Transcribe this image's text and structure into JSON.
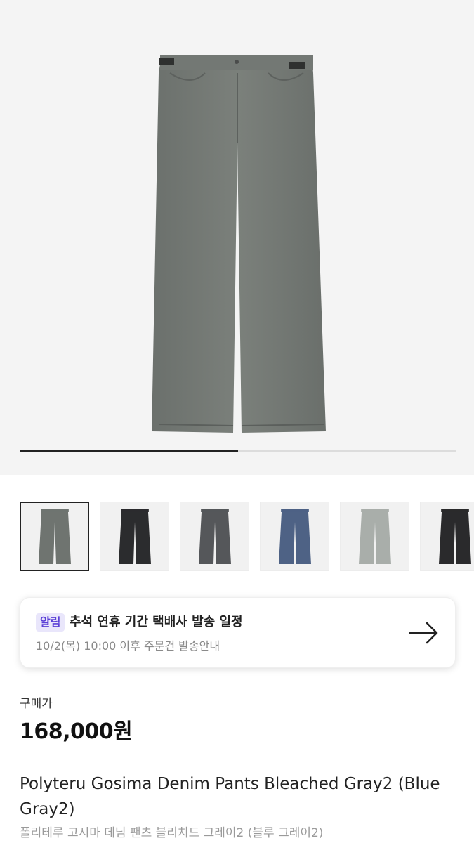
{
  "gallery": {
    "main_image": "product-photo-bleached-gray-pants",
    "progress_fraction": 0.5,
    "thumbnails": [
      {
        "name": "bleached-gray",
        "color": "#6f7470"
      },
      {
        "name": "black",
        "color": "#2b2c2e"
      },
      {
        "name": "charcoal",
        "color": "#55575a"
      },
      {
        "name": "blue",
        "color": "#4e6285"
      },
      {
        "name": "light-gray",
        "color": "#a9aeaa"
      },
      {
        "name": "black-2",
        "color": "#2a2a2c"
      }
    ]
  },
  "notice": {
    "badge": "알림",
    "title": "추석 연휴 기간 택배사 발송 일정",
    "subtitle": "10/2(목) 10:00 이후 주문건 발송안내",
    "arrow_icon": "arrow-right-icon"
  },
  "product": {
    "price_label": "구매가",
    "price": "168,000원",
    "title_en": "Polyteru Gosima Denim Pants Bleached Gray2 (Blue Gray2)",
    "title_ko": "폴리테루 고시마 데님 팬츠 블리치드 그레이2 (블루 그레이2)"
  },
  "colors": {
    "badge_bg": "#e9e6fb",
    "badge_text": "#5a3fd6",
    "hero_bg": "#f4f4f4"
  }
}
